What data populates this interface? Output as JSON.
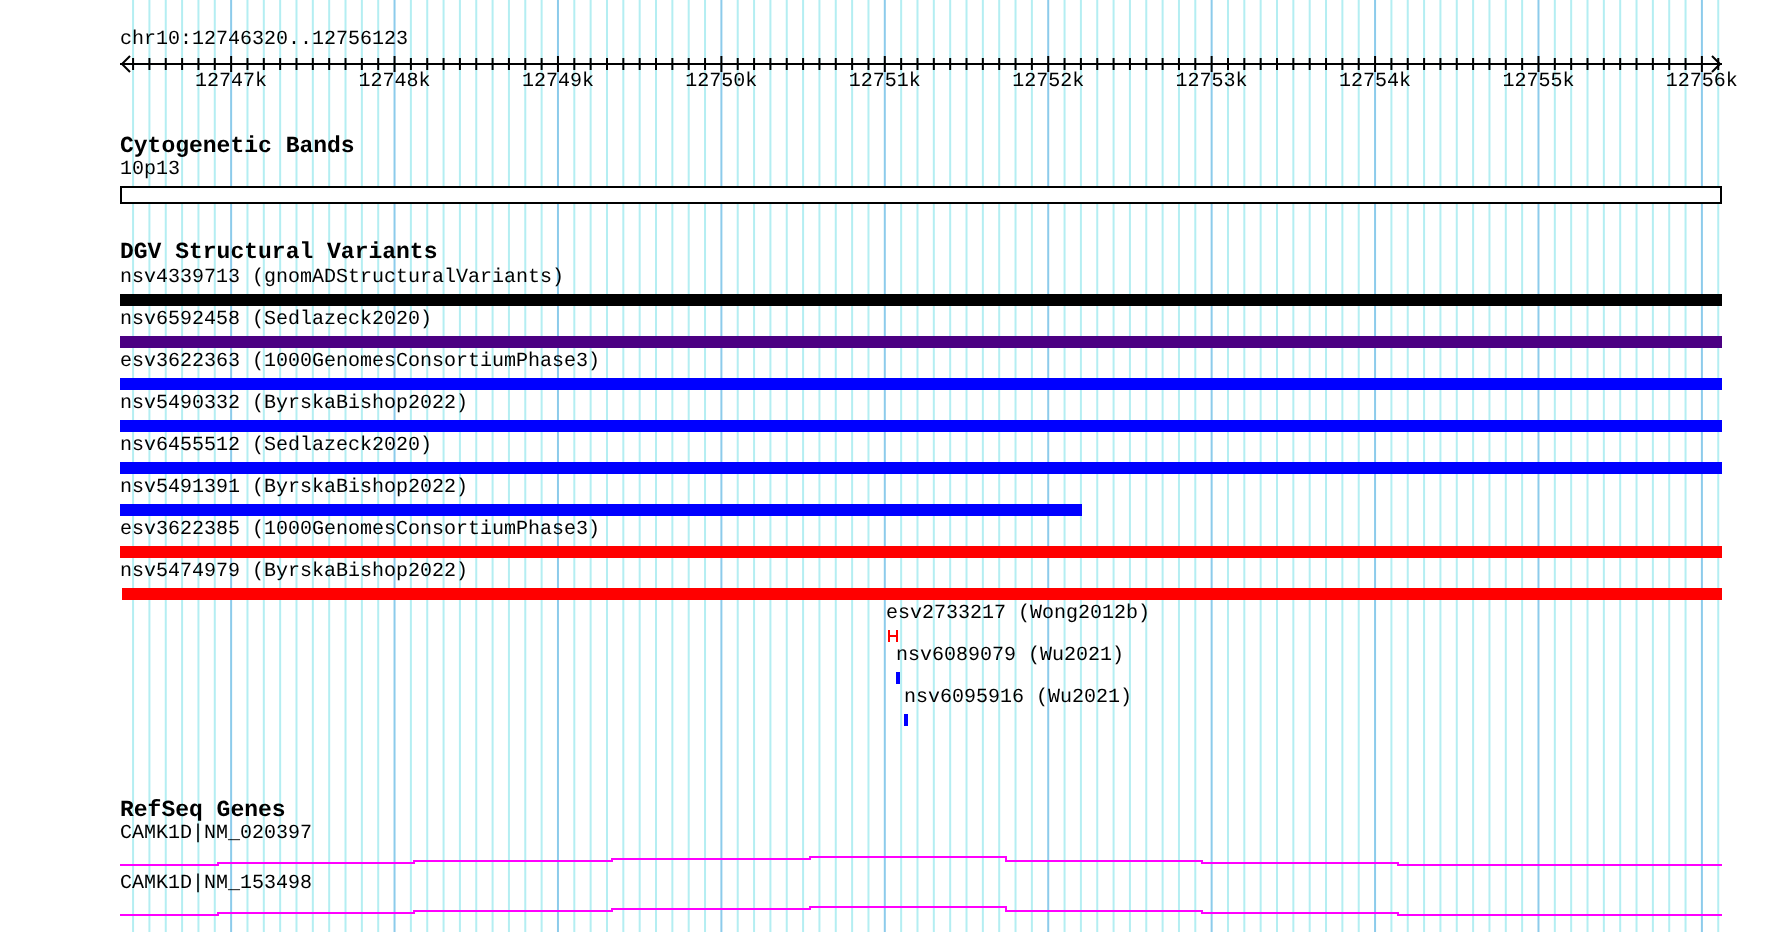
{
  "ruler": {
    "location": "chr10:12746320..12756123",
    "ticks": [
      "12747k",
      "12748k",
      "12749k",
      "12750k",
      "12751k",
      "12752k",
      "12753k",
      "12754k",
      "12755k",
      "12756k"
    ]
  },
  "tracks": [
    {
      "kind": "bands",
      "title": "Cytogenetic Bands",
      "features": [
        {
          "label": "10p13"
        }
      ]
    },
    {
      "kind": "variants",
      "title": "DGV Structural Variants",
      "features": [
        {
          "label": "nsv4339713 (gnomADStructuralVariants)",
          "color": "#000000"
        },
        {
          "label": "nsv6592458 (Sedlazeck2020)",
          "color": "#4b0082"
        },
        {
          "label": "esv3622363 (1000GenomesConsortiumPhase3)",
          "color": "#0000ff"
        },
        {
          "label": "nsv5490332 (ByrskaBishop2022)",
          "color": "#0000ff"
        },
        {
          "label": "nsv6455512 (Sedlazeck2020)",
          "color": "#0000ff"
        },
        {
          "label": "nsv5491391 (ByrskaBishop2022)",
          "color": "#0000ff"
        },
        {
          "label": "esv3622385 (1000GenomesConsortiumPhase3)",
          "color": "#ff0000"
        },
        {
          "label": "nsv5474979 (ByrskaBishop2022)",
          "color": "#ff0000"
        },
        {
          "label": "esv2733217 (Wong2012b)",
          "color": "#ff0000"
        },
        {
          "label": "nsv6089079 (Wu2021)",
          "color": "#0000ff"
        },
        {
          "label": "nsv6095916 (Wu2021)",
          "color": "#0000ff"
        }
      ]
    },
    {
      "kind": "genes",
      "title": "RefSeq Genes",
      "features": [
        {
          "label": "CAMK1D|NM_020397"
        },
        {
          "label": "CAMK1D|NM_153498"
        }
      ]
    }
  ]
}
